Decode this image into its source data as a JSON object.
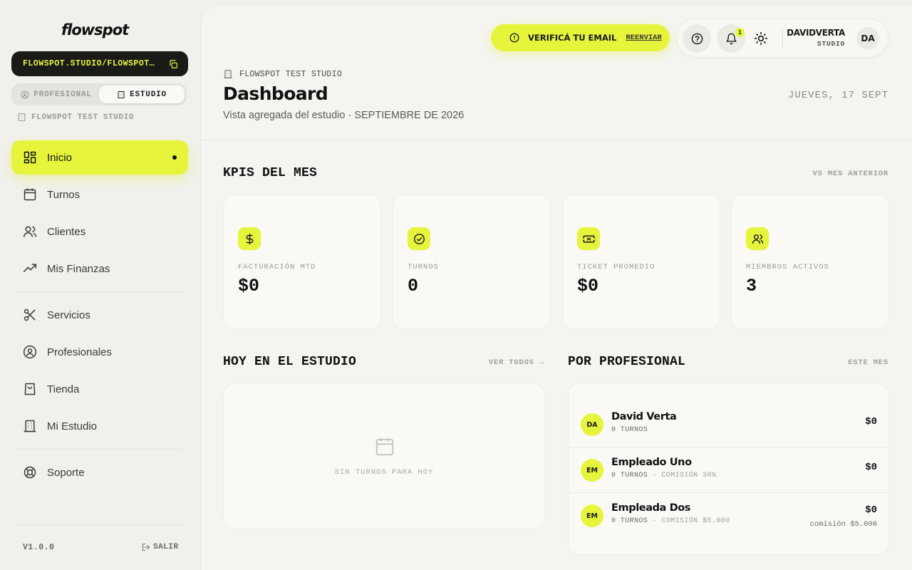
{
  "app": {
    "logo": "flowspot",
    "workspace_url": "FLOWSPOT.STUDIO/FLOWSPOT…",
    "mode_toggle": {
      "options": [
        "PROFESIONAL",
        "ESTUDIO"
      ],
      "selected": "ESTUDIO"
    },
    "studio_name": "FLOWSPOT TEST STUDIO",
    "version": "V1.0.0",
    "logout_label": "SALIR"
  },
  "sidebar": {
    "items": [
      {
        "label": "Inicio",
        "icon": "grid-icon",
        "active": true
      },
      {
        "label": "Turnos",
        "icon": "calendar-icon"
      },
      {
        "label": "Clientes",
        "icon": "users-icon"
      },
      {
        "label": "Mis Finanzas",
        "icon": "trending-up-icon"
      },
      {
        "label": "Servicios",
        "icon": "scissors-icon"
      },
      {
        "label": "Profesionales",
        "icon": "user-circle-icon"
      },
      {
        "label": "Tienda",
        "icon": "shopping-bag-icon"
      },
      {
        "label": "Mi Estudio",
        "icon": "building-icon"
      },
      {
        "label": "Soporte",
        "icon": "lifebuoy-icon"
      }
    ]
  },
  "topbar": {
    "verify_text": "VERIFICÁ TU EMAIL",
    "verify_link": "REENVIAR",
    "notification_count": "1",
    "user_name": "DAVIDVERTA",
    "user_role": "STUDIO",
    "user_initials": "DA"
  },
  "header": {
    "breadcrumb": "FLOWSPOT TEST STUDIO",
    "title": "Dashboard",
    "subtitle": "Vista agregada del estudio · SEPTIEMBRE DE 2026",
    "date": "JUEVES, 17 SEPT"
  },
  "kpis": {
    "title": "KPIS DEL MES",
    "meta": "VS MES ANTERIOR",
    "cards": [
      {
        "label": "FACTURACIÓN MTD",
        "value": "$0",
        "icon": "dollar-icon"
      },
      {
        "label": "TURNOS",
        "value": "0",
        "icon": "check-circle-icon"
      },
      {
        "label": "TICKET PROMEDIO",
        "value": "$0",
        "icon": "ticket-icon"
      },
      {
        "label": "MIEMBROS ACTIVOS",
        "value": "3",
        "icon": "users-icon"
      }
    ]
  },
  "today": {
    "title": "HOY EN EL ESTUDIO",
    "link": "VER TODOS →",
    "empty_text": "SIN TURNOS PARA HOY"
  },
  "per_pro": {
    "title": "POR PROFESIONAL",
    "meta": "ESTE MES",
    "rows": [
      {
        "initials": "DA",
        "name": "David Verta",
        "turnos": "0 TURNOS",
        "extra": "",
        "amount": "$0",
        "amount_sub": ""
      },
      {
        "initials": "EM",
        "name": "Empleado Uno",
        "turnos": "0 TURNOS",
        "extra": "· COMISIÓN 30%",
        "amount": "$0",
        "amount_sub": ""
      },
      {
        "initials": "EM",
        "name": "Empleada Dos",
        "turnos": "0 TURNOS",
        "extra": "· COMISIÓN $5.000",
        "amount": "$0",
        "amount_sub": "comisión $5.000"
      }
    ]
  },
  "colors": {
    "accent": "#e6f53c",
    "dark": "#1a1a17",
    "background": "#f1f0ec"
  }
}
